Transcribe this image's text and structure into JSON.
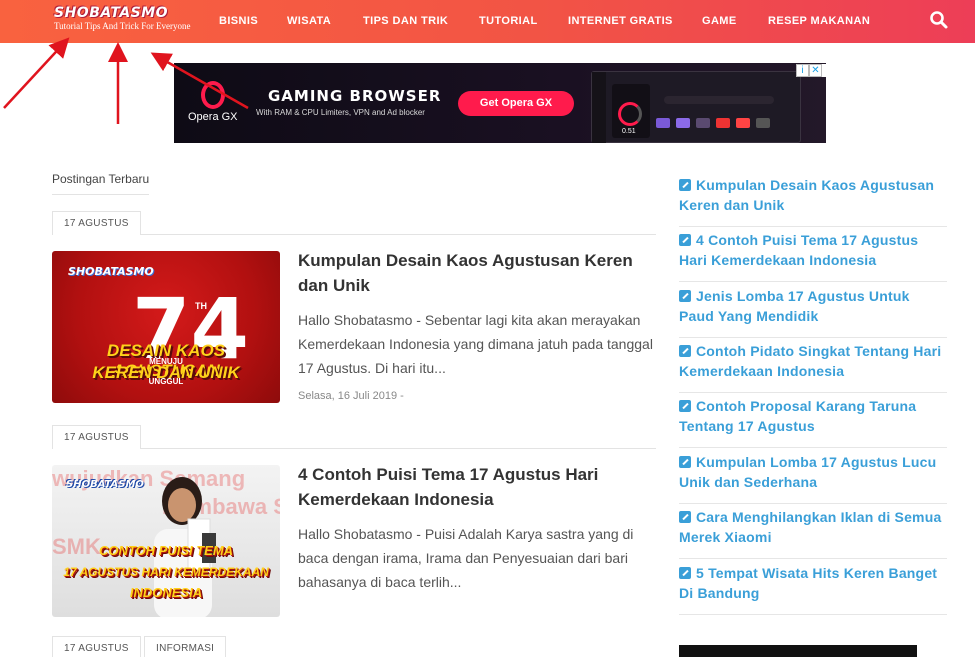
{
  "header": {
    "logo_title": "SHOBATASMO",
    "logo_tagline": "Tutorial Tips And Trick For Everyone",
    "nav": [
      "BISNIS",
      "WISATA",
      "TIPS DAN TRIK",
      "TUTORIAL",
      "INTERNET GRATIS",
      "GAME",
      "RESEP MAKANAN"
    ],
    "search_icon": "search-icon",
    "colors": {
      "start": "#f9623f",
      "end": "#ed3e57"
    }
  },
  "ad": {
    "brand": "Opera GX",
    "title": "GAMING BROWSER",
    "subtitle": "With RAM & CPU Limiters, VPN and Ad blocker",
    "cta": "Get Opera GX",
    "gauge_value": "0.51",
    "info_icon": "i",
    "close_icon": "✕",
    "accent": "#ff1b4c"
  },
  "main": {
    "section_title": "Postingan Terbaru",
    "posts": [
      {
        "categories": [
          "17 AGUSTUS"
        ],
        "title": "Kumpulan Desain Kaos Agustusan Keren dan Unik",
        "excerpt": "Hallo Shobatasmo - Sebentar lagi kita akan merayakan Kemerdekaan Indonesia yang dimana jatuh pada tanggal 17 Agustus. Di hari itu...",
        "date": "Selasa, 16 Juli 2019",
        "date_suffix": "-",
        "thumb": {
          "brand": "SHOBATASMO",
          "number": "74",
          "number_suffix": "TH",
          "line1": "DESAIN KAOS AGUSTUSAN",
          "line2": "KEREN DAN UNIK",
          "small1": "MENUJU",
          "small2": "UNGGUL"
        }
      },
      {
        "categories": [
          "17 AGUSTUS"
        ],
        "title": "4 Contoh Puisi Tema 17 Agustus Hari Kemerdekaan Indonesia",
        "excerpt": "Hallo Shobatasmo -  Puisi Adalah Karya sastra yang di baca dengan irama, Irama dan Penyesuaian dari bari bahasanya di baca terlih...",
        "thumb": {
          "brand": "SHOBATASMO",
          "bg1": "wujudkan Semang",
          "bg2": "Membawa Sem",
          "bg3": "SMK",
          "line1": "CONTOH PUISI TEMA",
          "line2": "17 AGUSTUS HARI KEMERDEKAAN",
          "line3": "INDONESIA"
        }
      },
      {
        "categories": [
          "17 AGUSTUS",
          "INFORMASI"
        ]
      }
    ]
  },
  "sidebar": {
    "links": [
      "Kumpulan Desain Kaos Agustusan Keren dan Unik",
      "4 Contoh Puisi Tema 17 Agustus Hari Kemerdekaan Indonesia",
      "Jenis Lomba 17 Agustus Untuk Paud Yang Mendidik",
      "Contoh Pidato Singkat Tentang Hari Kemerdekaan Indonesia",
      "Contoh Proposal Karang Taruna Tentang 17 Agustus",
      "Kumpulan Lomba 17 Agustus Lucu Unik dan Sederhana",
      "Cara Menghilangkan Iklan di Semua Merek Xiaomi",
      "5 Tempat Wisata Hits Keren Banget Di Bandung"
    ],
    "link_icon": "edit-icon",
    "link_color": "#3a9fd8"
  }
}
